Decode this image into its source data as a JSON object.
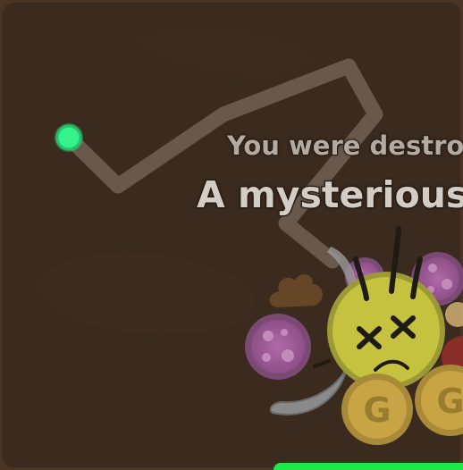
{
  "game": {
    "death_message": "You were destroyed by:",
    "killer_name": "A mysterious entity"
  },
  "scene": {
    "background_color": "#3b2a1e",
    "trail_color": "#cbbcae",
    "player_marker_color": "#33f08a",
    "player_state": "dead",
    "health_bar_color": "#1ee84a"
  },
  "icons": {
    "player": "dead-bee-icon",
    "coin_glyph": "G",
    "drops": [
      "coin-icon",
      "coin-icon",
      "grape-petal-icon",
      "grape-petal-icon",
      "grape-petal-icon",
      "dung-icon",
      "horn-icon",
      "antennae-icon"
    ]
  }
}
